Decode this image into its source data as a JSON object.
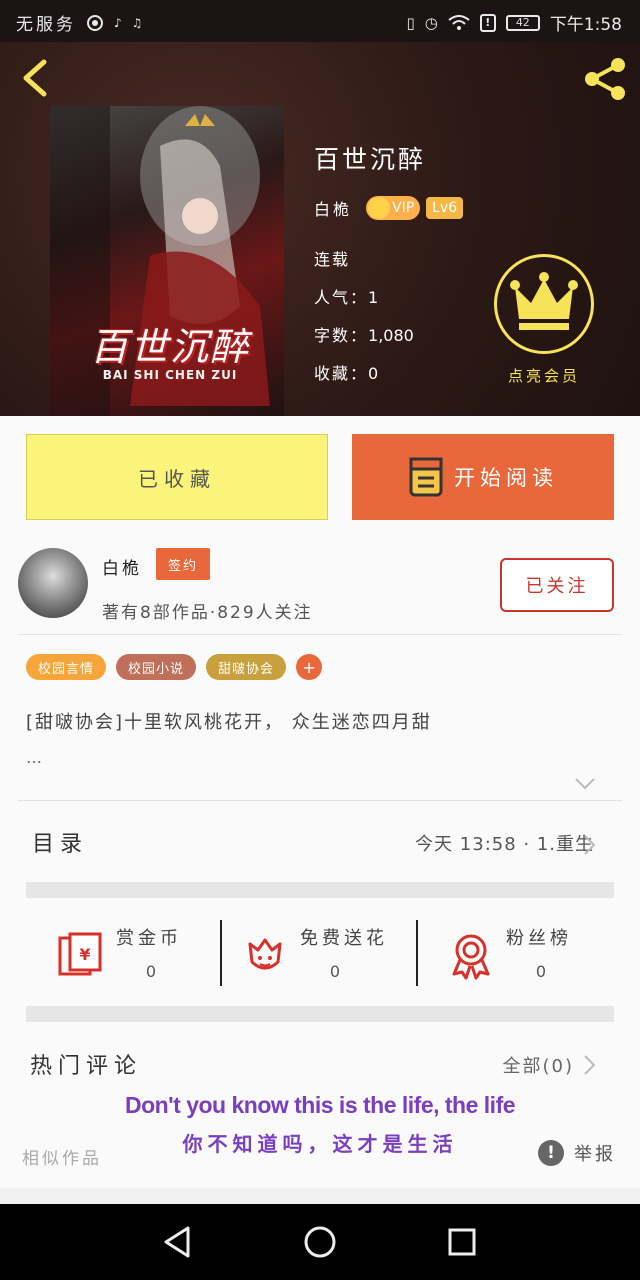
{
  "status_bar": {
    "carrier": "无服务",
    "time": "下午1:58",
    "battery": "42"
  },
  "book": {
    "title": "百世沉醉",
    "author": "白桅",
    "vip_label": "VIP",
    "level": "Lv6",
    "status": "连载",
    "popularity_label": "人气：",
    "popularity": "1",
    "words_label": "字数：",
    "words": "1,080",
    "favorites_label": "收藏：",
    "favorites": "0",
    "cover_title": "百世沉醉",
    "cover_subtitle": "BAI SHI CHEN ZUI",
    "become_vip": "点亮会员"
  },
  "actions": {
    "collected": "已收藏",
    "start_reading": "开始阅读"
  },
  "author_block": {
    "name": "白桅",
    "signed": "签约",
    "info": "著有8部作品·829人关注",
    "follow": "已关注"
  },
  "tags": [
    {
      "label": "校园言情",
      "color": "#f5a53a"
    },
    {
      "label": "校园小说",
      "color": "#c0705a"
    },
    {
      "label": "甜啵协会",
      "color": "#c9a03e"
    }
  ],
  "description": {
    "text": "[甜啵协会]十里软风桃花开， 众生迷恋四月甜",
    "more": "…"
  },
  "toc": {
    "label": "目录",
    "latest": "今天 13:58 · 1.重生"
  },
  "stats": [
    {
      "label": "赏金币",
      "count": "0",
      "icon": "red-envelope-icon"
    },
    {
      "label": "免费送花",
      "count": "0",
      "icon": "flower-icon"
    },
    {
      "label": "粉丝榜",
      "count": "0",
      "icon": "medal-icon"
    }
  ],
  "comments": {
    "label": "热门评论",
    "all": "全部(0)"
  },
  "lyrics": {
    "en": "Don't you know this is the life, the life",
    "cn": "你不知道吗，这才是生活"
  },
  "footer": {
    "similar": "相似作品",
    "report": "举报",
    "report_icon": "!"
  },
  "colors": {
    "accent_orange": "#e8683b",
    "collect_yellow": "#fbf47a",
    "gold": "#f6e35a",
    "follow_red": "#c9372c",
    "lyric_purple": "#7a3fc0"
  }
}
